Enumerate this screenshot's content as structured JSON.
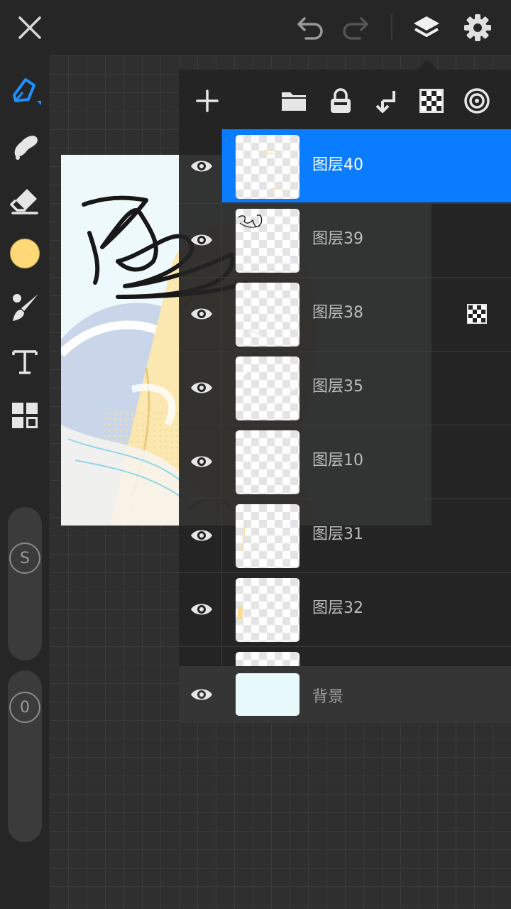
{
  "toolbar": {
    "icons": [
      "close-icon",
      "undo-icon",
      "redo-icon",
      "layers-icon",
      "settings-icon"
    ],
    "accent_color": "#0a7cff"
  },
  "tools": {
    "items": [
      "brush-icon",
      "smudge-icon",
      "eraser-icon",
      "color-swatch",
      "brush-settings-icon",
      "text-icon",
      "gallery-icon"
    ],
    "current_color": "#ffd878"
  },
  "sliders": {
    "size_label": "S",
    "opacity_label": "0"
  },
  "layers_panel": {
    "toolbar_icons": [
      "add-layer-icon",
      "folder-icon",
      "lock-icon",
      "merge-down-icon",
      "transparency-icon",
      "blend-mode-icon"
    ],
    "layers": [
      {
        "name": "图层40",
        "selected": true
      },
      {
        "name": "图层39",
        "selected": false
      },
      {
        "name": "图层38",
        "selected": false,
        "badge": "alpha-lock-icon"
      },
      {
        "name": "图层35",
        "selected": false
      },
      {
        "name": "图层10",
        "selected": false
      },
      {
        "name": "图层31",
        "selected": false
      },
      {
        "name": "图层32",
        "selected": false
      }
    ],
    "background": {
      "name": "背景",
      "color": "#e8f9fb"
    }
  }
}
